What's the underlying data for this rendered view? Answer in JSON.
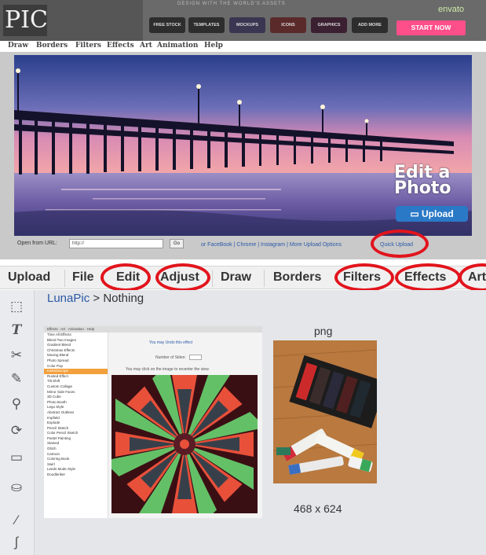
{
  "header": {
    "logo": "PIC",
    "ad_tagline": "DESIGN WITH THE WORLD'S ASSETS",
    "ad_buttons": [
      "FREE STOCK",
      "TEMPLATES",
      "MOCKUPS",
      "ICONS",
      "GRAPHICS",
      "ADD MORE"
    ],
    "envato": "envato",
    "start_now": "START NOW"
  },
  "old_menu": [
    "Draw",
    "Borders",
    "Filters",
    "Effects",
    "Art",
    "Animation",
    "Help"
  ],
  "hero": {
    "title": "Edit a Photo",
    "upload_label": "Upload",
    "url_label": "Open from URL:",
    "url_value": "http://",
    "go_label": "Go",
    "more_links": "or FaceBook | Chrome | Instagram | More Upload Options",
    "quick_upload": "Quick Upload"
  },
  "tabs": [
    "Upload",
    "File",
    "Edit",
    "Adjust",
    "Draw",
    "Borders",
    "Filters",
    "Effects",
    "Art"
  ],
  "circled_tabs": [
    "Edit",
    "Adjust",
    "Filters",
    "Effects",
    "Art"
  ],
  "breadcrumb": {
    "site": "LunaPic",
    "separator": " > ",
    "current": "Nothing"
  },
  "tools": [
    "select-icon",
    "text-icon",
    "scissors-icon",
    "pencil-icon",
    "zoom-icon",
    "rotate-icon",
    "layer-icon",
    "paint-bucket-icon",
    "eyedropper-icon",
    "brush-icon"
  ],
  "inner_preview": {
    "menu": "Effects · Art · Animation · Help",
    "effects": [
      "Time All Effects",
      "Blend Two Images",
      "Gradient Blend",
      "Christmas Effects",
      "Moving Blend",
      "Photo Spread",
      "Color Pop",
      "Kaleidoscope",
      "Rusted Effect",
      "Tilt Shift",
      "Custom Collage",
      "Mirror Side Faces",
      "3D Cube",
      "Photo Booth",
      "Lego Style",
      "Abstract Outlines",
      "Impfield",
      "Explode",
      "Pencil Sketch",
      "Color Pencil Sketch",
      "Pastel Painting",
      "Stained",
      "Glitch",
      "Cartoon",
      "Coloring Book",
      "Swirl",
      "Leeds Mode Style",
      "Doodleriker"
    ],
    "selected_effect": "Kaleidoscope",
    "undo_note": "You may Undo this effect",
    "sides_label": "Number of Sides:",
    "click_note": "You may click on the image to recenter the view."
  },
  "result": {
    "format": "png",
    "dimensions": "468 x 624"
  },
  "colors": {
    "annotation": "#e2141c",
    "link": "#2b59a5",
    "upload_button": "#2a79c7",
    "start_now": "#ff4f8a"
  }
}
